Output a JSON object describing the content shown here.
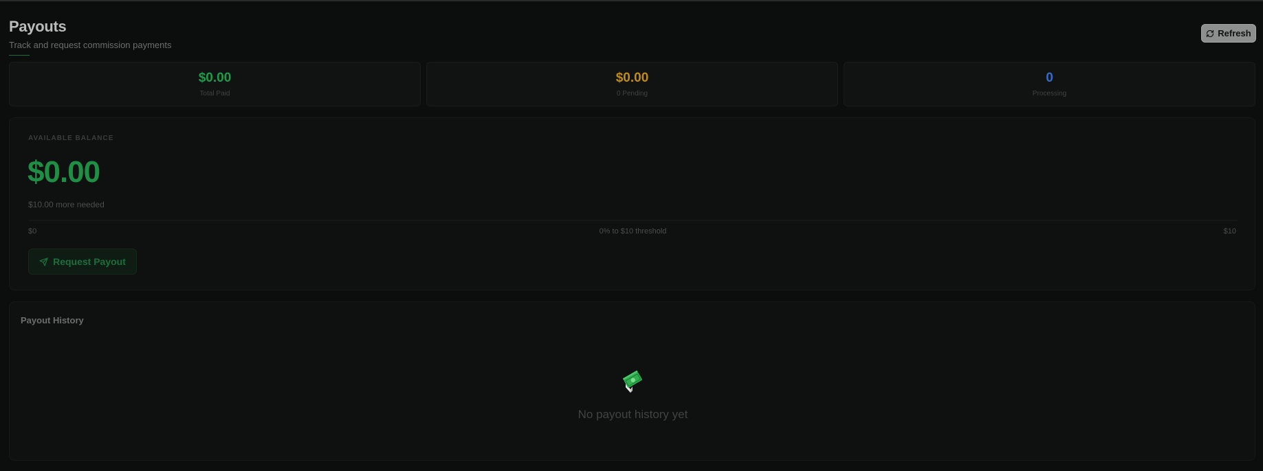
{
  "header": {
    "title": "Payouts",
    "subtitle": "Track and request commission payments"
  },
  "toolbar": {
    "refresh_label": "Refresh",
    "refresh_icon": "refresh-icon"
  },
  "stats": [
    {
      "value": "$0.00",
      "label": "Total Paid",
      "color": "#1f9a4b"
    },
    {
      "value": "$0.00",
      "label": "0 Pending",
      "color": "#c48a16"
    },
    {
      "value": "0",
      "label": "Processing",
      "color": "#3a6bc4"
    }
  ],
  "balance": {
    "label": "AVAILABLE BALANCE",
    "amount": "$0.00",
    "needed_text": "$10.00 more needed",
    "progress_min": "$0",
    "progress_text": "0% to $10 threshold",
    "progress_max": "$10",
    "progress_fraction": 0,
    "request_label": "Request Payout",
    "request_icon": "send-icon"
  },
  "history": {
    "title": "Payout History",
    "empty_icon": "money-with-wings-icon",
    "empty_text": "No payout history yet"
  },
  "colors": {
    "accent_green": "#1f8f46",
    "pending_amber": "#c48a16",
    "processing_blue": "#3a6bc4"
  }
}
